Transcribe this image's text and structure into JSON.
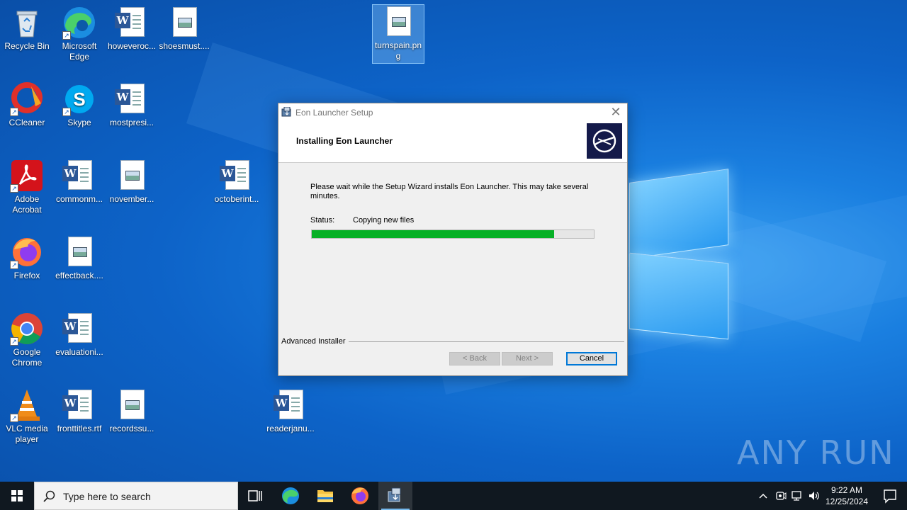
{
  "desktop": {
    "icons": [
      {
        "label": "Recycle Bin"
      },
      {
        "label": "Microsoft Edge"
      },
      {
        "label": "howeveroc..."
      },
      {
        "label": "shoesmust...."
      },
      {
        "label": "turnspain.png"
      },
      {
        "label": "CCleaner"
      },
      {
        "label": "Skype"
      },
      {
        "label": "mostpresi..."
      },
      {
        "label": "Adobe Acrobat"
      },
      {
        "label": "commonm..."
      },
      {
        "label": "november..."
      },
      {
        "label": "octoberint..."
      },
      {
        "label": "Firefox"
      },
      {
        "label": "effectback...."
      },
      {
        "label": "Google Chrome"
      },
      {
        "label": "evaluationi..."
      },
      {
        "label": "VLC media player"
      },
      {
        "label": "fronttitles.rtf"
      },
      {
        "label": "recordssu..."
      },
      {
        "label": "readerjanu..."
      }
    ]
  },
  "dialog": {
    "title": "Eon Launcher Setup",
    "close_glyph": "✕",
    "header_title": "Installing Eon Launcher",
    "message": "Please wait while the Setup Wizard installs Eon Launcher.  This may take several minutes.",
    "status_label": "Status:",
    "status_value": "Copying new files",
    "progress_percent": 86,
    "brand": "Advanced Installer",
    "back_label": "< Back",
    "next_label": "Next >",
    "cancel_label": "Cancel"
  },
  "watermark": "ANY RUN",
  "taskbar": {
    "search_placeholder": "Type here to search",
    "time": "9:22 AM",
    "date": "12/25/2024",
    "colors": {
      "active_indicator": "#76b9ed",
      "progress": "#06b025"
    }
  }
}
